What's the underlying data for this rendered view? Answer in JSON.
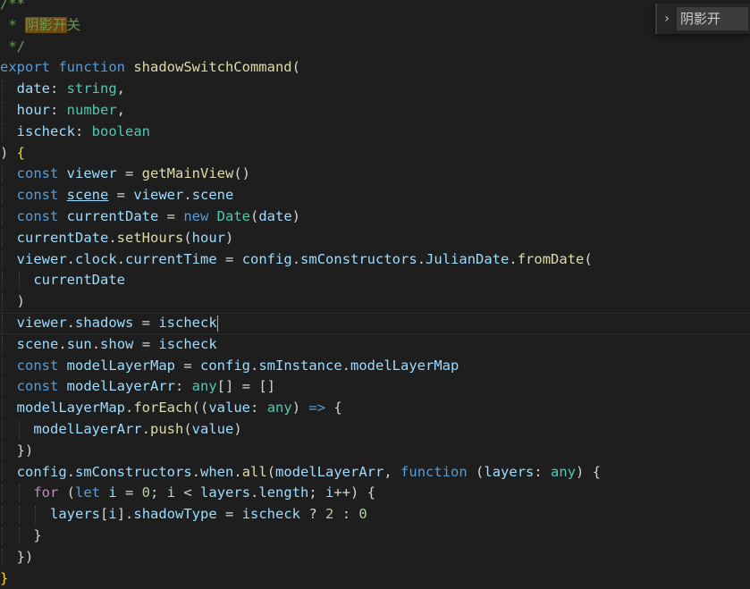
{
  "find_widget": {
    "toggle_glyph": "›",
    "query": "阴影开"
  },
  "code_lines": [
    [
      {
        "t": "/**",
        "c": "comment"
      }
    ],
    [
      {
        "t": " * ",
        "c": "comment"
      },
      {
        "t": "阴影开",
        "c": "comment",
        "h": true
      },
      {
        "t": "关",
        "c": "comment"
      }
    ],
    [
      {
        "t": " */",
        "c": "comment"
      }
    ],
    [
      {
        "t": "export ",
        "c": "keyword"
      },
      {
        "t": "function ",
        "c": "keyword"
      },
      {
        "t": "shadowSwitchCommand",
        "c": "function"
      },
      {
        "t": "(",
        "c": "plain"
      }
    ],
    [
      {
        "t": "  ",
        "c": "plain"
      },
      {
        "t": "date",
        "c": "variable"
      },
      {
        "t": ": ",
        "c": "plain"
      },
      {
        "t": "string",
        "c": "type"
      },
      {
        "t": ",",
        "c": "plain"
      }
    ],
    [
      {
        "t": "  ",
        "c": "plain"
      },
      {
        "t": "hour",
        "c": "variable"
      },
      {
        "t": ": ",
        "c": "plain"
      },
      {
        "t": "number",
        "c": "type"
      },
      {
        "t": ",",
        "c": "plain"
      }
    ],
    [
      {
        "t": "  ",
        "c": "plain"
      },
      {
        "t": "ischeck",
        "c": "variable"
      },
      {
        "t": ": ",
        "c": "plain"
      },
      {
        "t": "boolean",
        "c": "type"
      }
    ],
    [
      {
        "t": ") ",
        "c": "plain"
      },
      {
        "t": "{",
        "c": "bracket"
      }
    ],
    [
      {
        "t": "  ",
        "c": "plain"
      },
      {
        "t": "const ",
        "c": "keyword"
      },
      {
        "t": "viewer",
        "c": "variable"
      },
      {
        "t": " = ",
        "c": "plain"
      },
      {
        "t": "getMainView",
        "c": "function"
      },
      {
        "t": "()",
        "c": "plain"
      }
    ],
    [
      {
        "t": "  ",
        "c": "plain"
      },
      {
        "t": "const ",
        "c": "keyword"
      },
      {
        "t": "scene",
        "c": "variable",
        "u": true
      },
      {
        "t": " = ",
        "c": "plain"
      },
      {
        "t": "viewer",
        "c": "variable"
      },
      {
        "t": ".",
        "c": "plain"
      },
      {
        "t": "scene",
        "c": "variable"
      }
    ],
    [
      {
        "t": "  ",
        "c": "plain"
      },
      {
        "t": "const ",
        "c": "keyword"
      },
      {
        "t": "currentDate",
        "c": "variable"
      },
      {
        "t": " = ",
        "c": "plain"
      },
      {
        "t": "new ",
        "c": "keyword"
      },
      {
        "t": "Date",
        "c": "type"
      },
      {
        "t": "(",
        "c": "plain"
      },
      {
        "t": "date",
        "c": "variable"
      },
      {
        "t": ")",
        "c": "plain"
      }
    ],
    [
      {
        "t": "  ",
        "c": "plain"
      },
      {
        "t": "currentDate",
        "c": "variable"
      },
      {
        "t": ".",
        "c": "plain"
      },
      {
        "t": "setHours",
        "c": "function"
      },
      {
        "t": "(",
        "c": "plain"
      },
      {
        "t": "hour",
        "c": "variable"
      },
      {
        "t": ")",
        "c": "plain"
      }
    ],
    [
      {
        "t": "  ",
        "c": "plain"
      },
      {
        "t": "viewer",
        "c": "variable"
      },
      {
        "t": ".",
        "c": "plain"
      },
      {
        "t": "clock",
        "c": "variable"
      },
      {
        "t": ".",
        "c": "plain"
      },
      {
        "t": "currentTime",
        "c": "variable"
      },
      {
        "t": " = ",
        "c": "plain"
      },
      {
        "t": "config",
        "c": "variable"
      },
      {
        "t": ".",
        "c": "plain"
      },
      {
        "t": "smConstructors",
        "c": "variable"
      },
      {
        "t": ".",
        "c": "plain"
      },
      {
        "t": "JulianDate",
        "c": "variable"
      },
      {
        "t": ".",
        "c": "plain"
      },
      {
        "t": "fromDate",
        "c": "function"
      },
      {
        "t": "(",
        "c": "plain"
      }
    ],
    [
      {
        "t": "    ",
        "c": "plain"
      },
      {
        "t": "currentDate",
        "c": "variable"
      }
    ],
    [
      {
        "t": "  ",
        "c": "plain"
      },
      {
        "t": ")",
        "c": "plain"
      }
    ],
    [
      {
        "t": "  ",
        "c": "plain"
      },
      {
        "t": "viewer",
        "c": "variable"
      },
      {
        "t": ".",
        "c": "plain"
      },
      {
        "t": "shadows",
        "c": "variable"
      },
      {
        "t": " = ",
        "c": "plain"
      },
      {
        "t": "ischeck",
        "c": "variable"
      }
    ],
    [
      {
        "t": "  ",
        "c": "plain"
      },
      {
        "t": "scene",
        "c": "variable"
      },
      {
        "t": ".",
        "c": "plain"
      },
      {
        "t": "sun",
        "c": "variable"
      },
      {
        "t": ".",
        "c": "plain"
      },
      {
        "t": "show",
        "c": "variable"
      },
      {
        "t": " = ",
        "c": "plain"
      },
      {
        "t": "ischeck",
        "c": "variable"
      }
    ],
    [
      {
        "t": "  ",
        "c": "plain"
      },
      {
        "t": "const ",
        "c": "keyword"
      },
      {
        "t": "modelLayerMap",
        "c": "variable"
      },
      {
        "t": " = ",
        "c": "plain"
      },
      {
        "t": "config",
        "c": "variable"
      },
      {
        "t": ".",
        "c": "plain"
      },
      {
        "t": "smInstance",
        "c": "variable"
      },
      {
        "t": ".",
        "c": "plain"
      },
      {
        "t": "modelLayerMap",
        "c": "variable"
      }
    ],
    [
      {
        "t": "  ",
        "c": "plain"
      },
      {
        "t": "const ",
        "c": "keyword"
      },
      {
        "t": "modelLayerArr",
        "c": "variable"
      },
      {
        "t": ": ",
        "c": "plain"
      },
      {
        "t": "any",
        "c": "type"
      },
      {
        "t": "[] = []",
        "c": "plain"
      }
    ],
    [
      {
        "t": "  ",
        "c": "plain"
      },
      {
        "t": "modelLayerMap",
        "c": "variable"
      },
      {
        "t": ".",
        "c": "plain"
      },
      {
        "t": "forEach",
        "c": "function"
      },
      {
        "t": "((",
        "c": "plain"
      },
      {
        "t": "value",
        "c": "variable"
      },
      {
        "t": ": ",
        "c": "plain"
      },
      {
        "t": "any",
        "c": "type"
      },
      {
        "t": ") ",
        "c": "plain"
      },
      {
        "t": "=>",
        "c": "keyword"
      },
      {
        "t": " {",
        "c": "plain"
      }
    ],
    [
      {
        "t": "    ",
        "c": "plain"
      },
      {
        "t": "modelLayerArr",
        "c": "variable"
      },
      {
        "t": ".",
        "c": "plain"
      },
      {
        "t": "push",
        "c": "function"
      },
      {
        "t": "(",
        "c": "plain"
      },
      {
        "t": "value",
        "c": "variable"
      },
      {
        "t": ")",
        "c": "plain"
      }
    ],
    [
      {
        "t": "  })",
        "c": "plain"
      }
    ],
    [
      {
        "t": "  ",
        "c": "plain"
      },
      {
        "t": "config",
        "c": "variable"
      },
      {
        "t": ".",
        "c": "plain"
      },
      {
        "t": "smConstructors",
        "c": "variable"
      },
      {
        "t": ".",
        "c": "plain"
      },
      {
        "t": "when",
        "c": "variable"
      },
      {
        "t": ".",
        "c": "plain"
      },
      {
        "t": "all",
        "c": "function"
      },
      {
        "t": "(",
        "c": "plain"
      },
      {
        "t": "modelLayerArr",
        "c": "variable"
      },
      {
        "t": ", ",
        "c": "plain"
      },
      {
        "t": "function ",
        "c": "keyword"
      },
      {
        "t": "(",
        "c": "plain"
      },
      {
        "t": "layers",
        "c": "variable"
      },
      {
        "t": ": ",
        "c": "plain"
      },
      {
        "t": "any",
        "c": "type"
      },
      {
        "t": ") {",
        "c": "plain"
      }
    ],
    [
      {
        "t": "    ",
        "c": "plain"
      },
      {
        "t": "for ",
        "c": "control"
      },
      {
        "t": "(",
        "c": "plain"
      },
      {
        "t": "let ",
        "c": "keyword"
      },
      {
        "t": "i",
        "c": "variable"
      },
      {
        "t": " = ",
        "c": "plain"
      },
      {
        "t": "0",
        "c": "number"
      },
      {
        "t": "; ",
        "c": "plain"
      },
      {
        "t": "i",
        "c": "variable"
      },
      {
        "t": " < ",
        "c": "plain"
      },
      {
        "t": "layers",
        "c": "variable"
      },
      {
        "t": ".",
        "c": "plain"
      },
      {
        "t": "length",
        "c": "variable"
      },
      {
        "t": "; ",
        "c": "plain"
      },
      {
        "t": "i",
        "c": "variable"
      },
      {
        "t": "++) {",
        "c": "plain"
      }
    ],
    [
      {
        "t": "      ",
        "c": "plain"
      },
      {
        "t": "layers",
        "c": "variable"
      },
      {
        "t": "[",
        "c": "plain"
      },
      {
        "t": "i",
        "c": "variable"
      },
      {
        "t": "].",
        "c": "plain"
      },
      {
        "t": "shadowType",
        "c": "variable"
      },
      {
        "t": " = ",
        "c": "plain"
      },
      {
        "t": "ischeck",
        "c": "variable"
      },
      {
        "t": " ? ",
        "c": "plain"
      },
      {
        "t": "2",
        "c": "number"
      },
      {
        "t": " : ",
        "c": "plain"
      },
      {
        "t": "0",
        "c": "number"
      }
    ],
    [
      {
        "t": "    }",
        "c": "plain"
      }
    ],
    [
      {
        "t": "  })",
        "c": "plain"
      }
    ],
    [
      {
        "t": "}",
        "c": "bracket"
      }
    ]
  ]
}
